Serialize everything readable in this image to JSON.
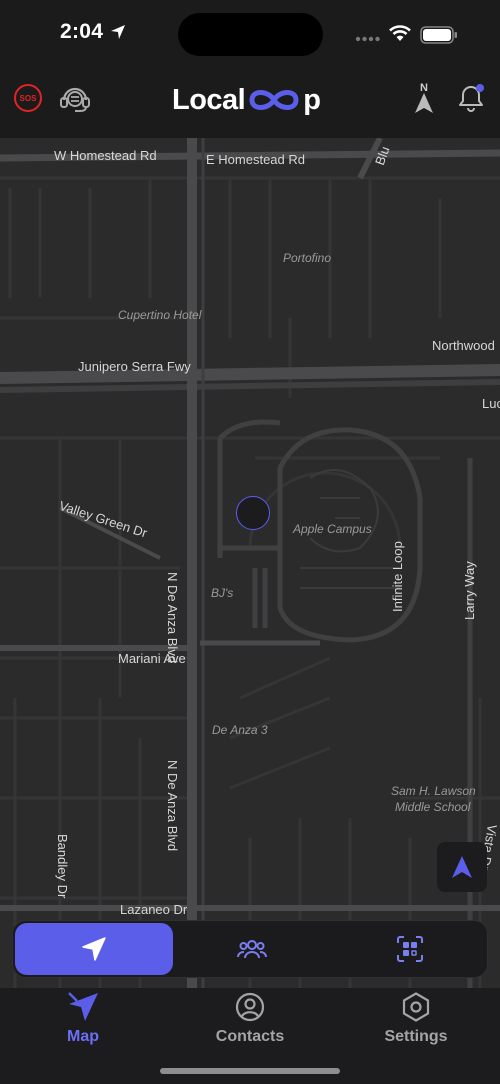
{
  "status_bar": {
    "time": "2:04"
  },
  "header": {
    "sos_label": "SOS",
    "logo_prefix": "Local",
    "logo_suffix": "p",
    "compass_label": "N"
  },
  "map": {
    "streets": {
      "w_homestead": "W Homestead Rd",
      "e_homestead": "E Homestead Rd",
      "blu": "Blu",
      "junipero": "Junipero Serra Fwy",
      "northwood": "Northwood",
      "luc": "Luc",
      "valley_green": "Valley Green Dr",
      "de_anza_1": "N De Anza Blvd",
      "de_anza_2": "N De Anza Blvd",
      "infinite_loop": "Infinite Loop",
      "larry_way": "Larry Way",
      "mariani": "Mariani Ave",
      "bandley": "Bandley Dr",
      "lazaneo": "Lazaneo Dr",
      "vista": "Vista Dr"
    },
    "pois": {
      "portofino": "Portofino",
      "cupertino_hotel": "Cupertino Hotel",
      "apple_campus": "Apple Campus",
      "bjs": "BJ's",
      "de_anza_3": "De Anza 3",
      "lawson_1": "Sam H. Lawson",
      "lawson_2": "Middle School"
    }
  },
  "segment": {
    "selected_index": 0
  },
  "tabs": [
    {
      "label": "Map",
      "icon": "map-navigation-icon",
      "active": true
    },
    {
      "label": "Contacts",
      "icon": "person-circle-icon",
      "active": false
    },
    {
      "label": "Settings",
      "icon": "hexagon-gear-icon",
      "active": false
    }
  ],
  "colors": {
    "accent": "#5a5ee8",
    "sos": "#e02424",
    "map_bg": "#2b2b2c"
  }
}
